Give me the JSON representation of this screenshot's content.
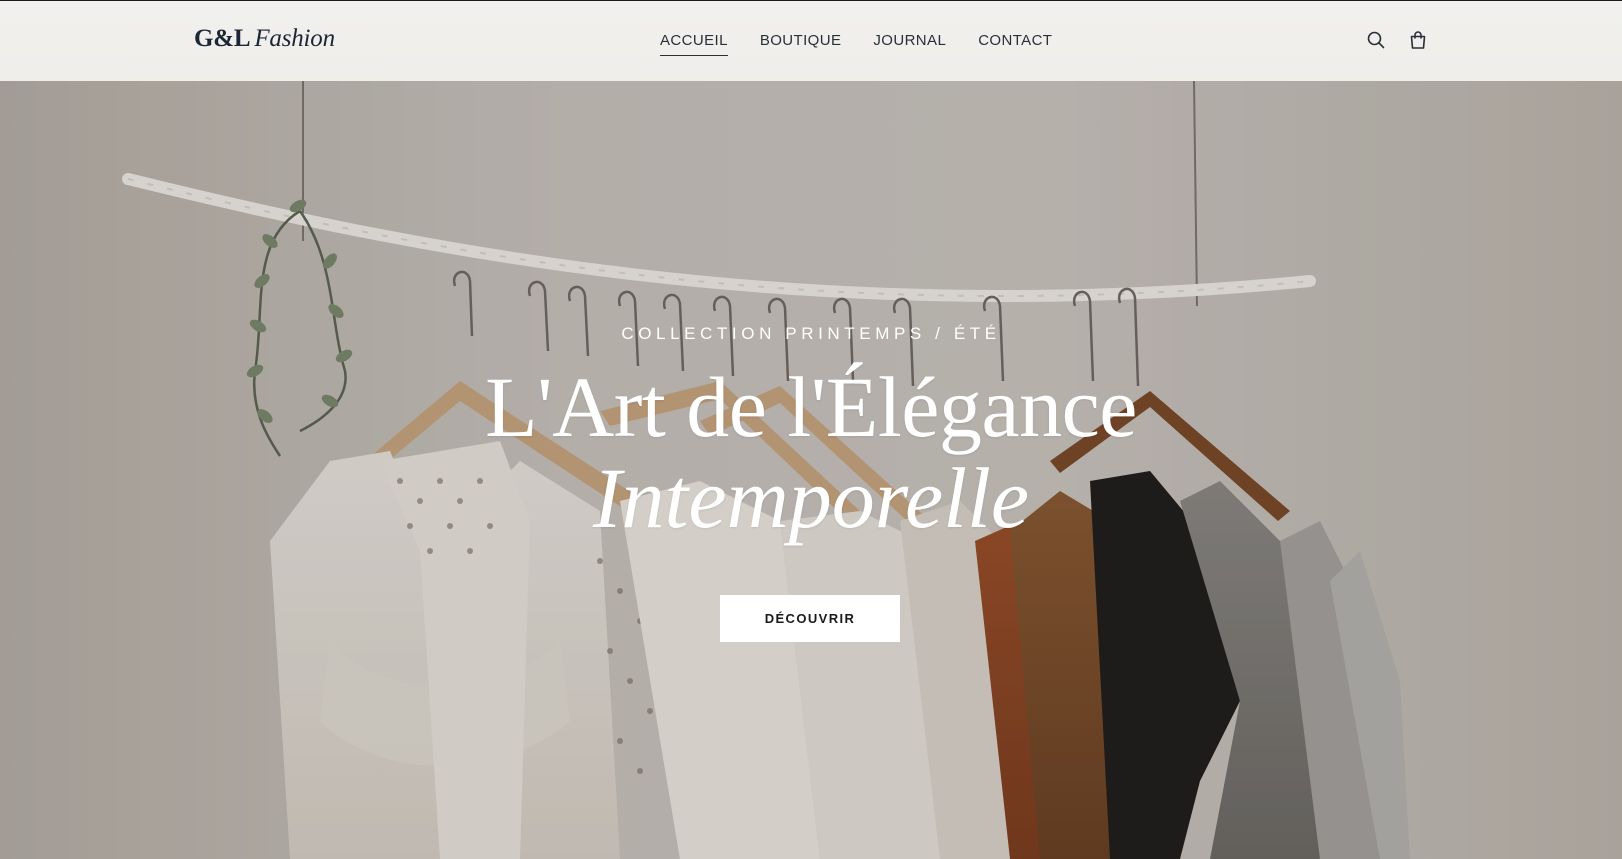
{
  "brand": {
    "logo_strong": "G&L",
    "logo_em": "Fashion"
  },
  "nav": {
    "items": [
      {
        "label": "ACCUEIL",
        "active": true
      },
      {
        "label": "BOUTIQUE",
        "active": false
      },
      {
        "label": "JOURNAL",
        "active": false
      },
      {
        "label": "CONTACT",
        "active": false
      }
    ]
  },
  "header_icons": [
    "search-icon",
    "shopping-bag-icon"
  ],
  "hero": {
    "eyebrow": "COLLECTION PRINTEMPS / ÉTÉ",
    "title_line1": "L'Art de l'Élégance",
    "title_line2": "Intemporelle",
    "cta_label": "DÉCOUVRIR",
    "image": "clothing-rack-photo"
  },
  "colors": {
    "header_bg": "#efeeeb",
    "nav_text": "#2a2f3a",
    "logo_text": "#1d2636",
    "hero_text": "#ffffff",
    "cta_bg": "#ffffff",
    "cta_text": "#1a1a1a"
  }
}
